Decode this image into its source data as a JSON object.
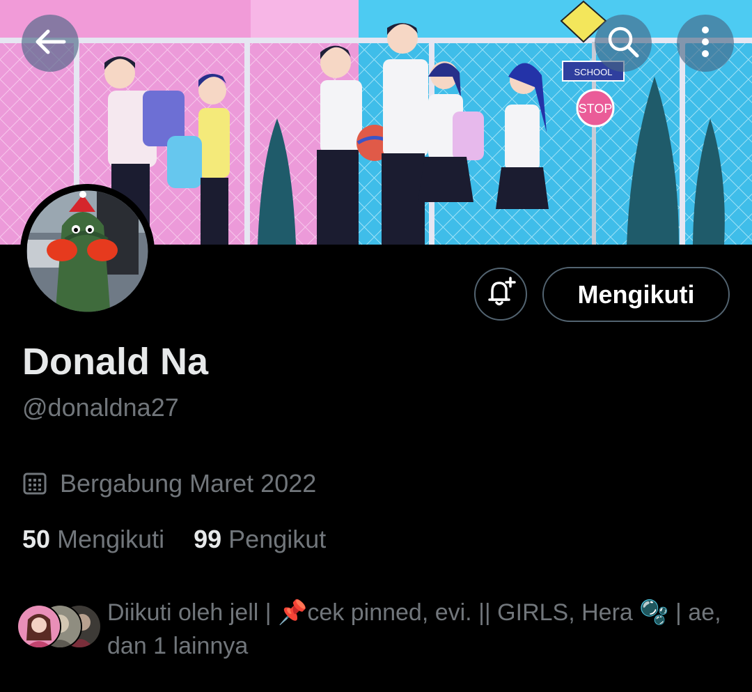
{
  "header": {
    "back_icon": "arrow-left-icon",
    "search_icon": "search-icon",
    "more_icon": "more-vertical-icon"
  },
  "banner": {
    "school_sign": "SCHOOL",
    "stop_sign": "STOP"
  },
  "profile": {
    "name": "Donald Na",
    "handle": "@donaldna27",
    "follow_button": "Mengikuti",
    "notify_icon": "bell-plus-icon",
    "joined_icon": "calendar-icon",
    "joined": "Bergabung Maret 2022"
  },
  "stats": {
    "following_count": "50",
    "following_label": "Mengikuti",
    "followers_count": "99",
    "followers_label": "Pengikut"
  },
  "followed_by": {
    "text": "Diikuti oleh jell | 📌cek pinned, evi. || GIRLS, Hera 🫧 | ae, dan 1 lainnya"
  },
  "colors": {
    "background": "#000000",
    "secondary_text": "#71767b",
    "primary_text": "#e7e9ea",
    "button_border": "#536471",
    "banner_pink": "#f2a6dc",
    "banner_blue": "#49c4ee"
  }
}
